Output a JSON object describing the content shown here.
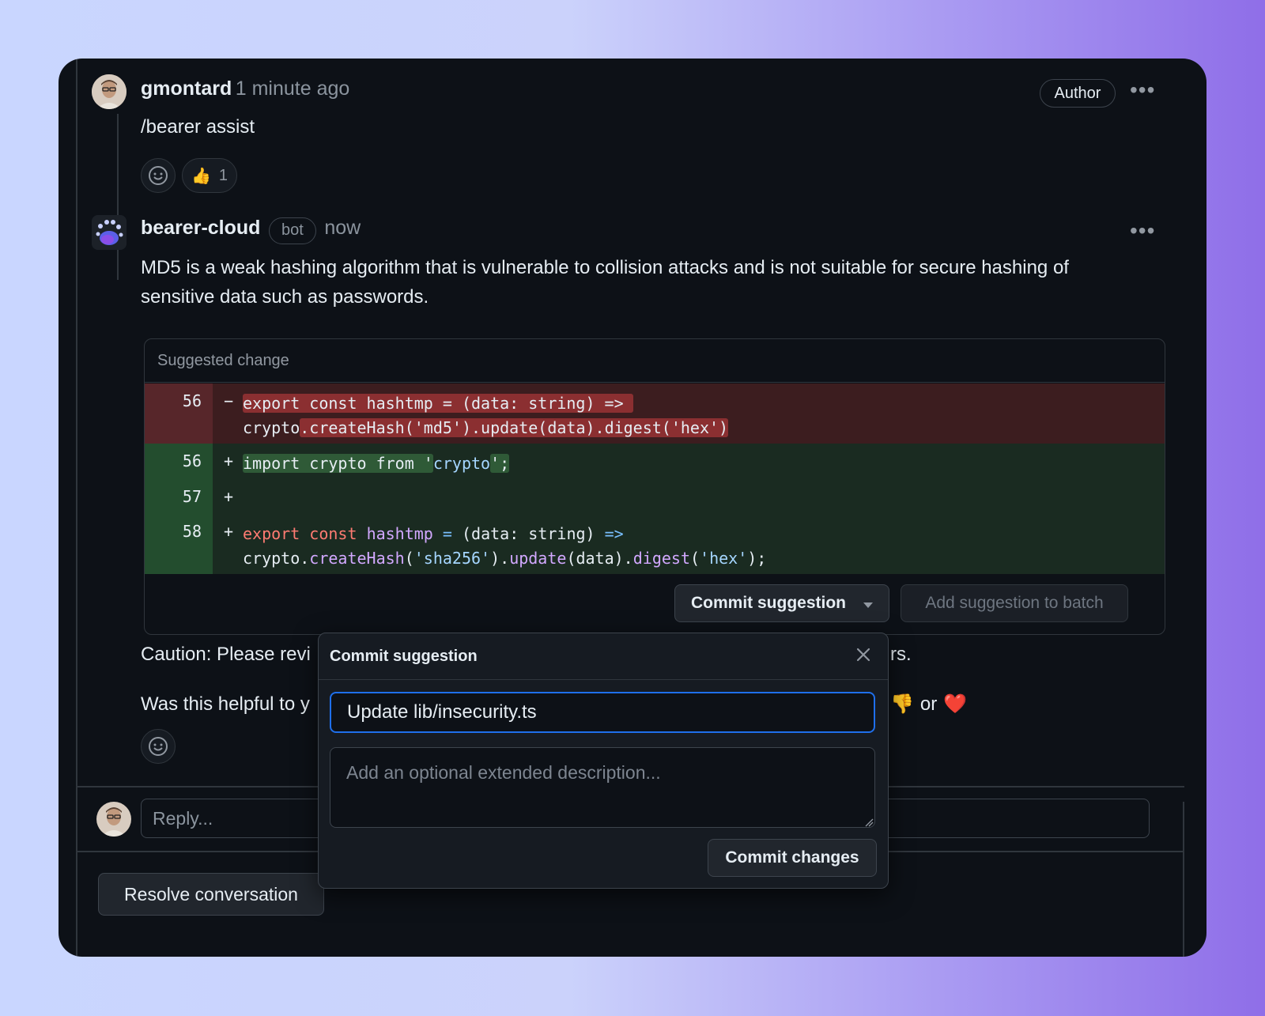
{
  "comment1": {
    "user": "gmontard",
    "time": "1 minute ago",
    "badge": "Author",
    "body": "/bearer assist",
    "reaction_emoji": "👍",
    "reaction_count": "1"
  },
  "comment2": {
    "user": "bearer-cloud",
    "bot_badge": "bot",
    "time": "now",
    "body": "MD5 is a weak hashing algorithm that is vulnerable to collision attacks and is not suitable for secure hashing of sensitive data such as passwords.",
    "caution_start": "Caution: Please revi",
    "caution_end": "rs.",
    "helpful_start": "Was this helpful to y",
    "helpful_or": "or",
    "thumbs_down_emoji": "👎",
    "heart_emoji": "❤️"
  },
  "suggestion": {
    "header": "Suggested change",
    "deleted": {
      "line": "56",
      "sign": "−"
    },
    "added": [
      {
        "line": "56",
        "sign": "+"
      },
      {
        "line": "57",
        "sign": "+"
      },
      {
        "line": "58",
        "sign": "+"
      }
    ],
    "commit_button": "Commit suggestion",
    "batch_button": "Add suggestion to batch"
  },
  "popover": {
    "title": "Commit suggestion",
    "message_value": "Update lib/insecurity.ts",
    "description_placeholder": "Add an optional extended description...",
    "commit_changes_button": "Commit changes"
  },
  "reply": {
    "placeholder": "Reply..."
  },
  "resolve_button": "Resolve conversation",
  "icons": [
    "smiley-icon",
    "kebab-icon",
    "close-icon",
    "caret-down-icon",
    "resize-handle-icon"
  ],
  "colors": {
    "accent": "#1f6feb",
    "deletion": "#3c1d1f",
    "addition": "#1a2b21"
  }
}
